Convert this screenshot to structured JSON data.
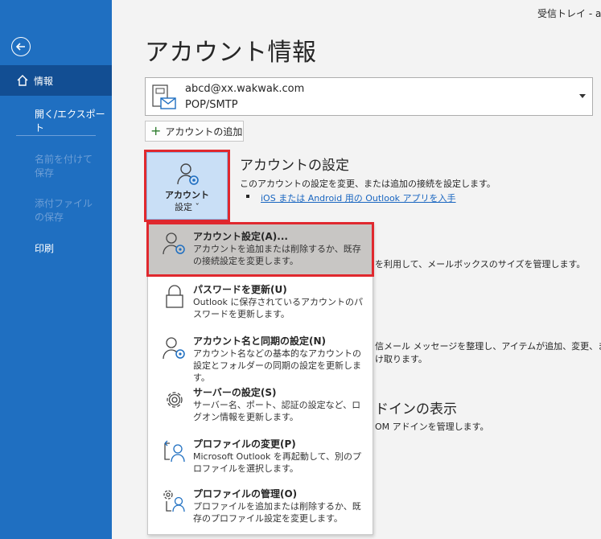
{
  "window": {
    "title": "受信トレイ - abcd"
  },
  "sidebar": {
    "back": "back-icon",
    "items": [
      {
        "label": "情報",
        "active": true
      },
      {
        "label": "開く/エクスポート"
      },
      {
        "label": "名前を付けて保存",
        "disabled": true
      },
      {
        "label": "添付ファイルの保存",
        "disabled": true
      },
      {
        "label": "印刷"
      }
    ]
  },
  "main": {
    "title": "アカウント情報",
    "account": {
      "email": "abcd@xx.wakwak.com",
      "type": "POP/SMTP"
    },
    "add_account": "アカウントの追加",
    "settings_button": {
      "line1": "アカウント",
      "line2": "設定 ˇ"
    },
    "settings_section": {
      "heading": "アカウントの設定",
      "description": "このアカウントの設定を変更、または追加の接続を設定します。",
      "link": "iOS または Android 用の Outlook アプリを入手"
    },
    "background_fragments": [
      "を利用して、メールボックスのサイズを管理します。",
      "信メール メッセージを整理し、アイテムが追加、変更、ま",
      "け取ります。",
      "ドインの表示",
      "OM アドインを管理します。"
    ]
  },
  "menu": {
    "items": [
      {
        "title": "アカウント設定(A)...",
        "desc": "アカウントを追加または削除するか、既存の接続設定を変更します。",
        "icon": "account-settings-icon"
      },
      {
        "title": "パスワードを更新(U)",
        "desc": "Outlook に保存されているアカウントのパスワードを更新します。",
        "icon": "lock-icon"
      },
      {
        "title": "アカウント名と同期の設定(N)",
        "desc": "アカウント名などの基本的なアカウントの設定とフォルダーの同期の設定を更新します。",
        "icon": "account-sync-icon"
      },
      {
        "title": "サーバーの設定(S)",
        "desc": "サーバー名、ポート、認証の設定など、ログオン情報を更新します。",
        "icon": "gear-icon"
      },
      {
        "title": "プロファイルの変更(P)",
        "desc": "Microsoft Outlook を再起動して、別のプロファイルを選択します。",
        "icon": "profile-change-icon"
      },
      {
        "title": "プロファイルの管理(O)",
        "desc": "プロファイルを追加または削除するか、既存のプロファイル設定を変更します。",
        "icon": "profile-manage-icon"
      }
    ]
  },
  "colors": {
    "sidebar": "#1f6fc1",
    "sidebar_active": "#124e93",
    "highlight": "#e0282e",
    "link": "#1865c0"
  }
}
